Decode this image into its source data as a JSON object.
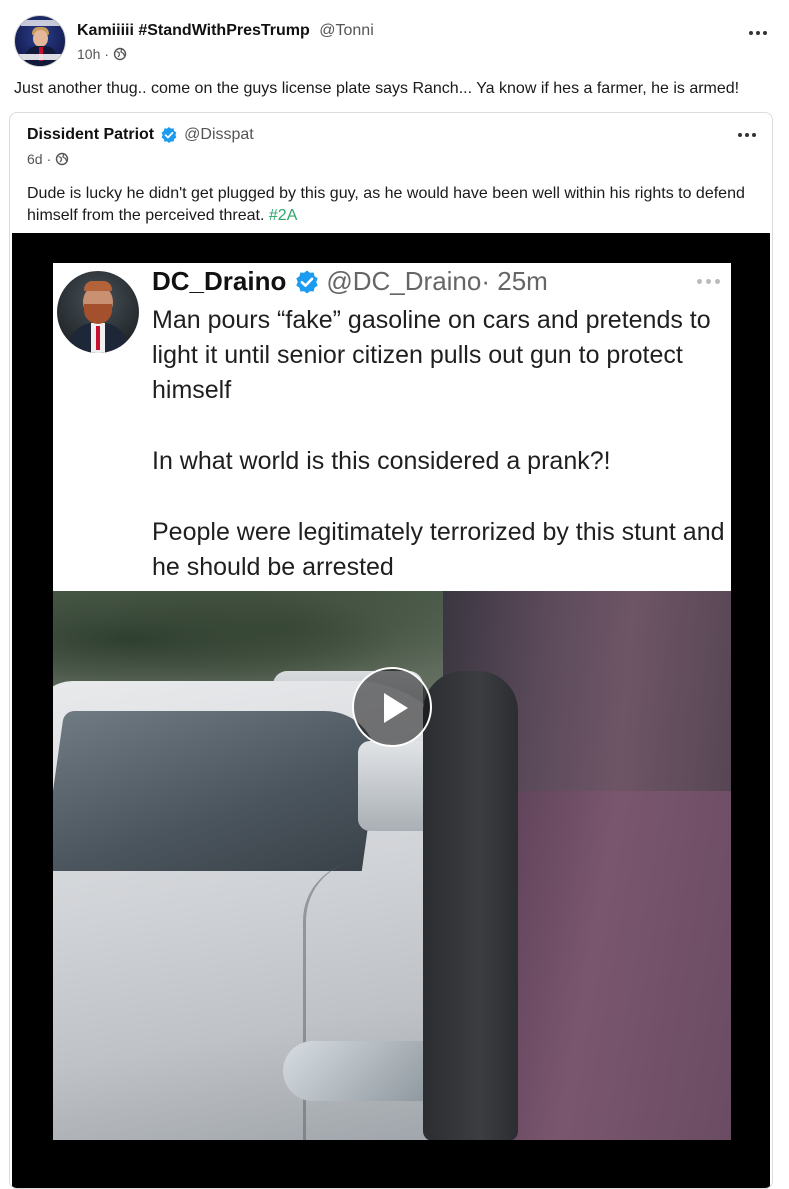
{
  "post": {
    "author_name": "Kamiiiii #StandWithPresTrump",
    "author_handle": "@Tonni",
    "timestamp": "10h",
    "meta_separator": "·",
    "visibility_icon": "globe-icon",
    "more_icon": "ellipsis-icon",
    "text": "Just another thug.. come on the guys license plate says Ranch... Ya know if hes a farmer, he is armed!"
  },
  "quoted_post": {
    "author_name": "Dissident Patriot",
    "verified_icon": "verified-badge-icon",
    "author_handle": "@Disspat",
    "timestamp": "6d",
    "meta_separator": "·",
    "visibility_icon": "globe-icon",
    "more_icon": "ellipsis-icon",
    "text_before_hashtag": "Dude is lucky he didn't get plugged by this guy, as he would have been well within his rights to defend himself from the perceived threat.",
    "hashtag": "#2A",
    "hashtag_color": "#2ca56a",
    "video": {
      "play_icon": "play-icon",
      "embedded_tweet": {
        "author_name": "DC_Draino",
        "verified_icon": "verified-badge-icon",
        "author_handle": "@DC_Draino",
        "time": "· 25m",
        "paragraphs": [
          "Man pours “fake” gasoline on cars and pretends to light it until senior citizen pulls out gun to protect himself",
          "In what world is this considered a prank?!",
          "People were legitimately terrorized by this stunt and he should be arrested"
        ]
      }
    }
  },
  "colors": {
    "verified_blue": "#1d9bf0",
    "card_border": "#dcdcdc",
    "video_background": "#000000"
  }
}
